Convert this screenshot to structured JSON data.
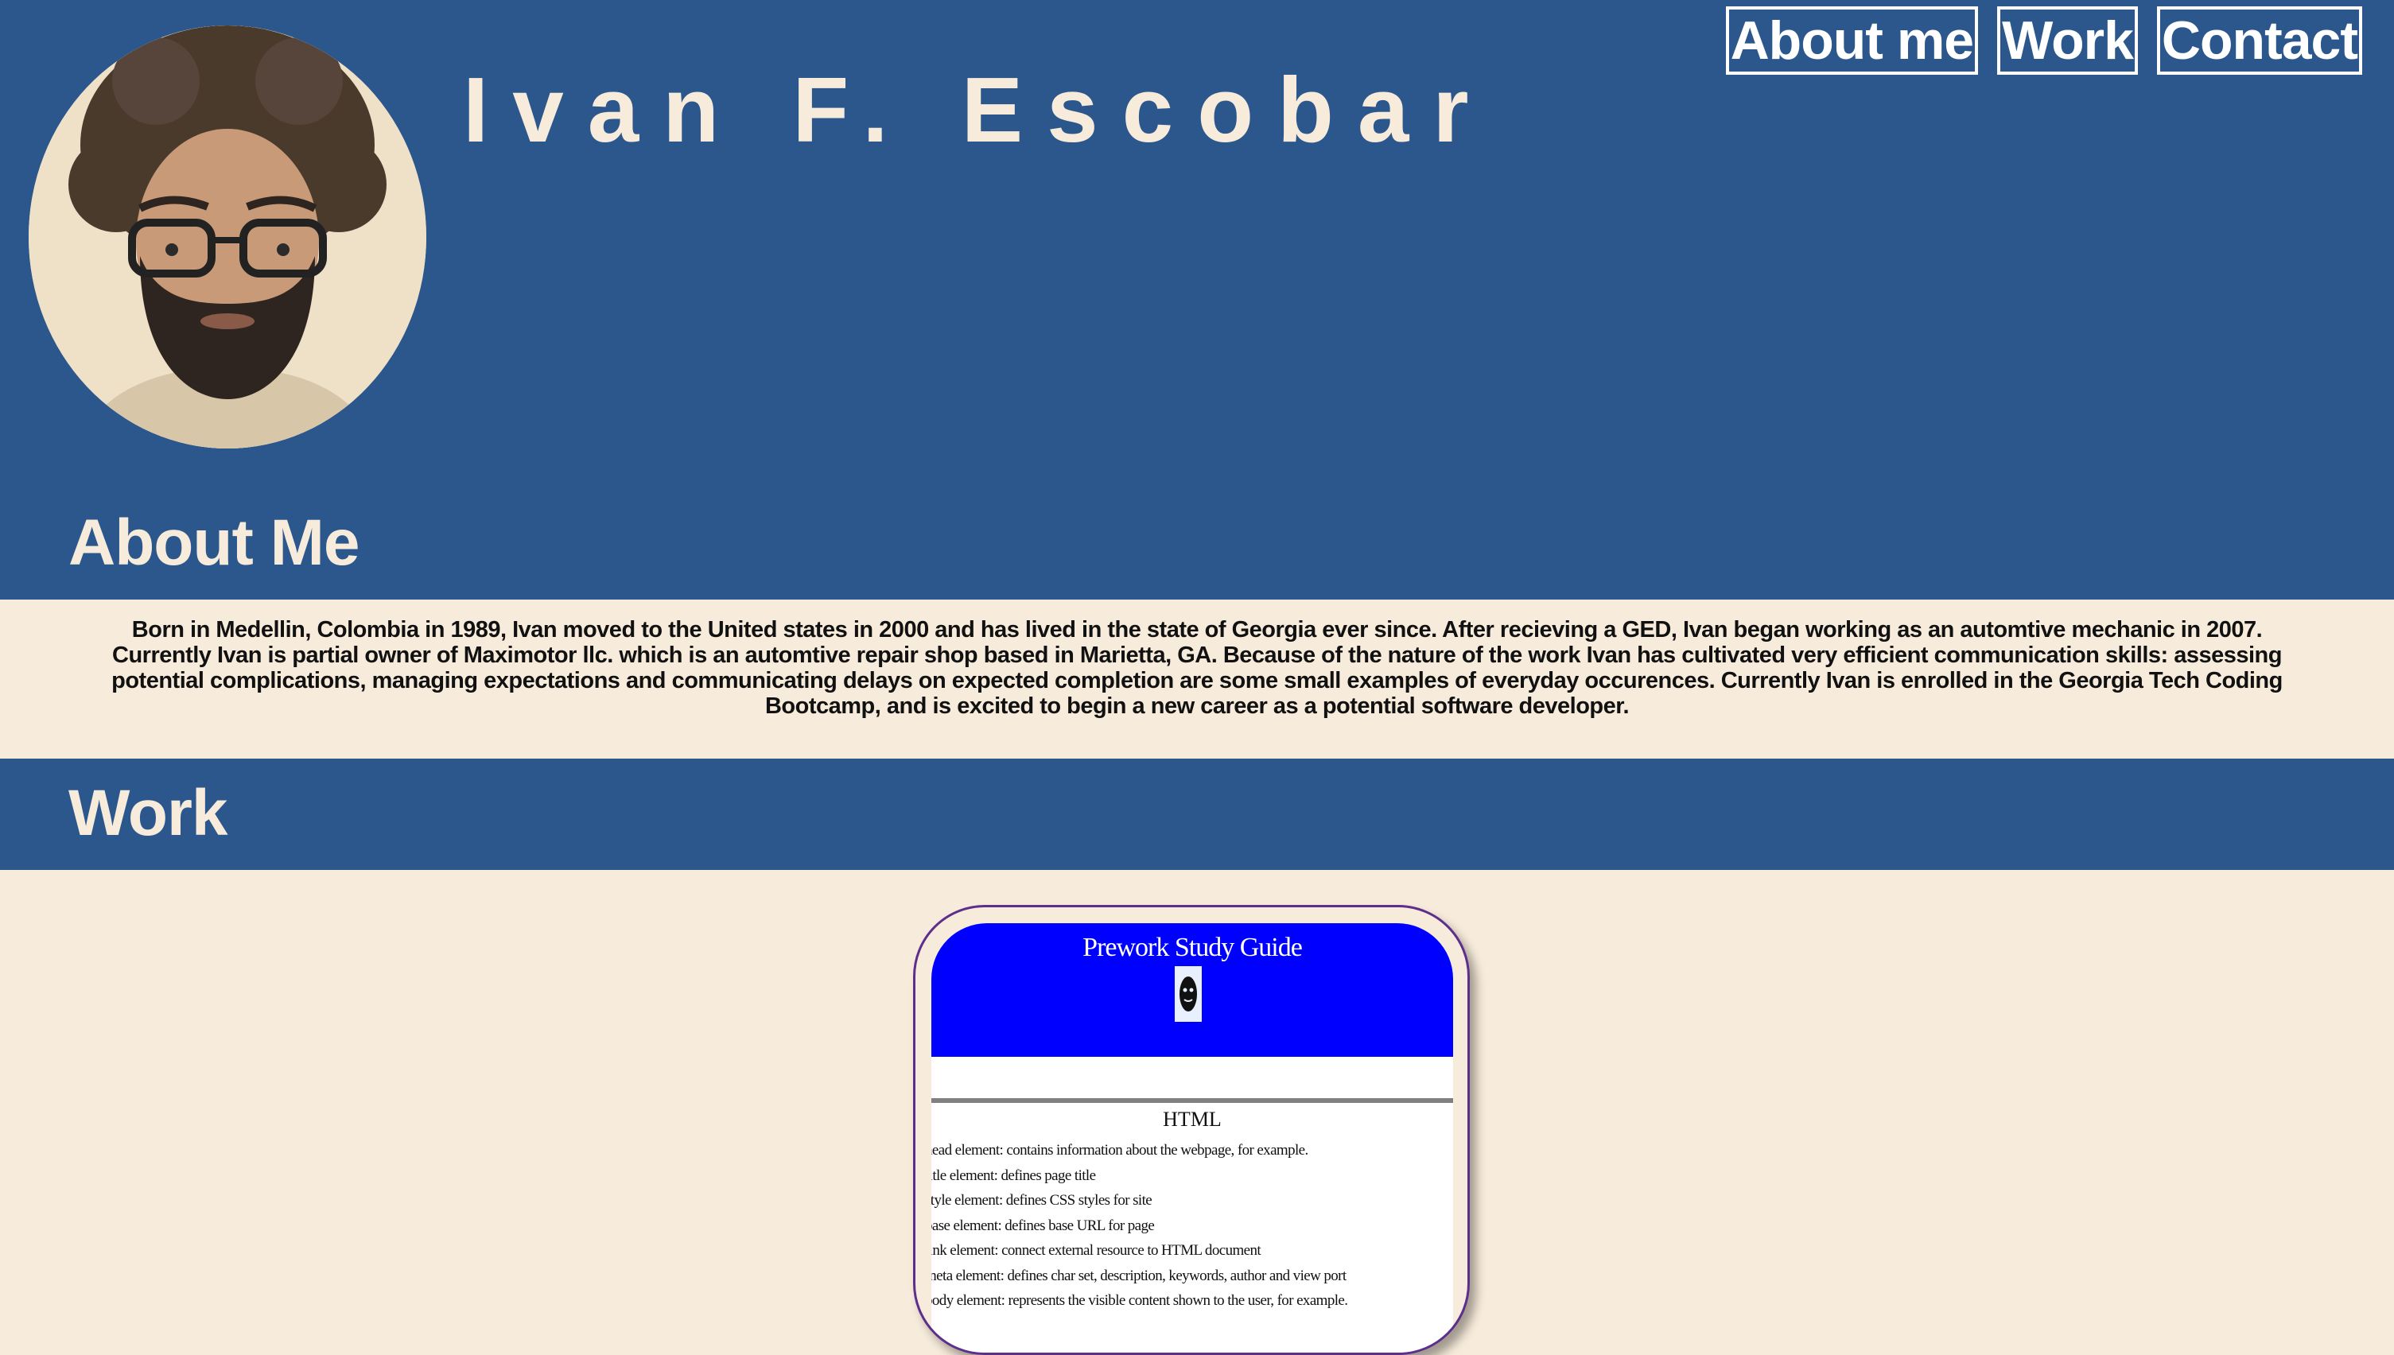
{
  "header": {
    "name": "Ivan F. Escobar",
    "avatar_alt": "portrait photo"
  },
  "nav": {
    "items": [
      {
        "label": "About me"
      },
      {
        "label": "Work"
      },
      {
        "label": "Contact"
      }
    ]
  },
  "about": {
    "title": "About Me",
    "text": "Born in Medellin, Colombia in 1989, Ivan moved to the United states in 2000 and has lived in the state of Georgia ever since. After recieving a GED, Ivan began working as an automtive mechanic in 2007. Currently Ivan is partial owner of Maximotor llc. which is an automtive repair shop based in Marietta, GA. Because of the nature of the work Ivan has cultivated very efficient communication skills: assessing potential complications, managing expectations and communicating delays on expected completion are some small examples of everyday occurences. Currently Ivan is enrolled in the Georgia Tech Coding Bootcamp, and is excited to begin a new career as a potential software developer."
  },
  "work": {
    "title": "Work",
    "card": {
      "title": "Prework Study Guide",
      "section_heading": "HTML",
      "lines": [
        "head element: contains information about the webpage, for example.",
        "title element: defines page title",
        "style element: defines CSS styles for site",
        "base element: defines base URL for page",
        "link element: connect external resource to HTML document",
        "meta element: defines char set, description, keywords, author and view port",
        "body element: represents the visible content shown to the user, for example."
      ]
    }
  },
  "colors": {
    "header_blue": "#2b578c",
    "cream": "#f7ebdb",
    "card_border": "#5d2e8c",
    "card_header": "#0000ff"
  }
}
